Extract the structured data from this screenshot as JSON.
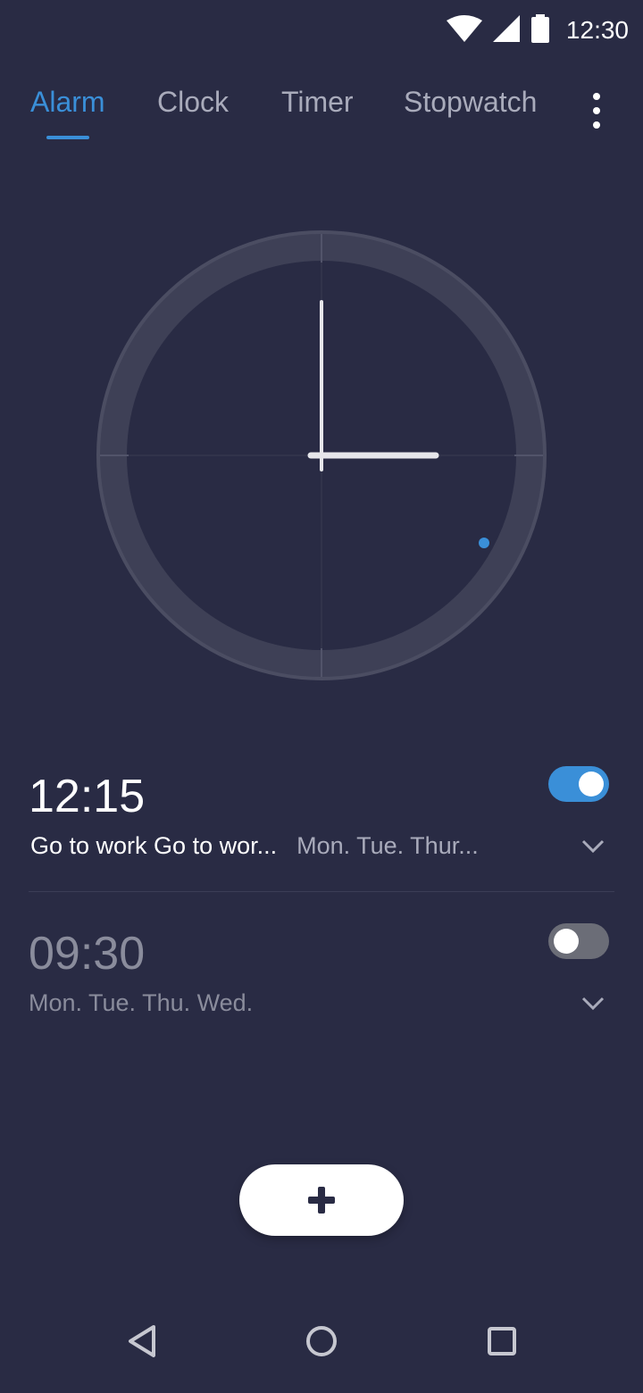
{
  "status_bar": {
    "time": "12:30",
    "icons": [
      "wifi-icon",
      "cellular-signal-icon",
      "battery-icon"
    ]
  },
  "tabs": [
    {
      "label": "Alarm",
      "active": true
    },
    {
      "label": "Clock",
      "active": false
    },
    {
      "label": "Timer",
      "active": false
    },
    {
      "label": "Stopwatch",
      "active": false
    }
  ],
  "more_menu_icon": "more-vert-icon",
  "colors": {
    "background": "#292b44",
    "accent": "#3a8fd8",
    "muted_text": "#a9abbb",
    "dial_ring": "#3e4056",
    "toggle_off": "#6b6d77"
  },
  "alarms": [
    {
      "time": "12:15",
      "label": "Go to work Go to wor...",
      "days": "Mon. Tue. Thur...",
      "enabled": true
    },
    {
      "time": "09:30",
      "label": "",
      "days": "Mon. Tue. Thu. Wed.",
      "enabled": false
    }
  ],
  "fab_icon": "plus-icon",
  "navbar": {
    "icons": [
      "back-icon",
      "home-icon",
      "recents-icon"
    ]
  }
}
